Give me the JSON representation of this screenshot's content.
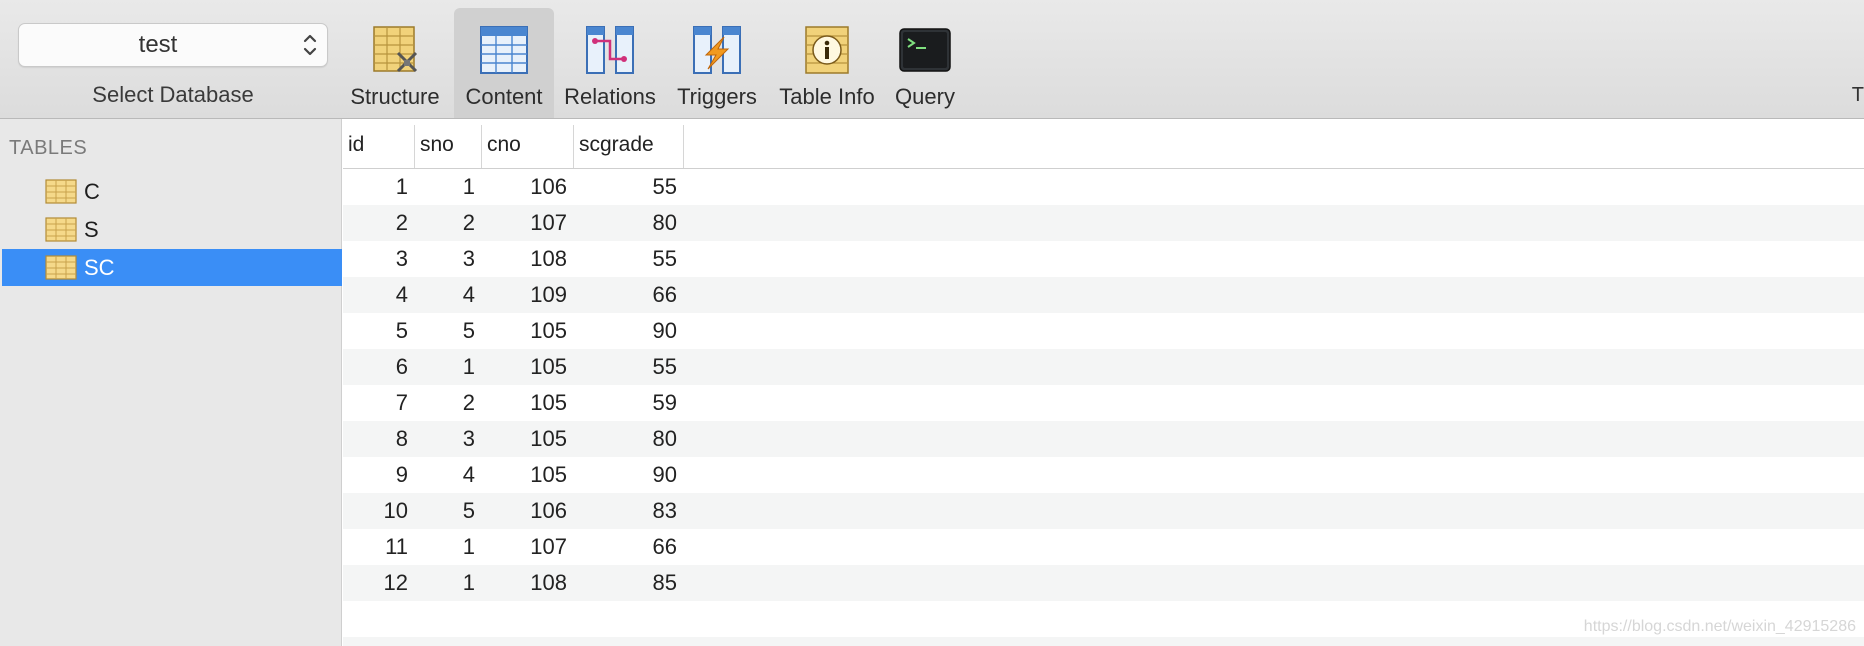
{
  "toolbar": {
    "database_value": "test",
    "database_label": "Select Database",
    "tabs": [
      {
        "label": "Structure"
      },
      {
        "label": "Content"
      },
      {
        "label": "Relations"
      },
      {
        "label": "Triggers"
      },
      {
        "label": "Table Info"
      },
      {
        "label": "Query"
      }
    ],
    "active_tab": "Content",
    "edge_text": "T"
  },
  "sidebar": {
    "heading": "TABLES",
    "items": [
      {
        "label": "C",
        "icon": "table-icon"
      },
      {
        "label": "S",
        "icon": "table-icon"
      },
      {
        "label": "SC",
        "icon": "table-icon",
        "selected": true
      }
    ],
    "selected_color": "#3a8ef6"
  },
  "table": {
    "columns": [
      "id",
      "sno",
      "cno",
      "scgrade"
    ],
    "rows": [
      [
        "1",
        "1",
        "106",
        "55"
      ],
      [
        "2",
        "2",
        "107",
        "80"
      ],
      [
        "3",
        "3",
        "108",
        "55"
      ],
      [
        "4",
        "4",
        "109",
        "66"
      ],
      [
        "5",
        "5",
        "105",
        "90"
      ],
      [
        "6",
        "1",
        "105",
        "55"
      ],
      [
        "7",
        "2",
        "105",
        "59"
      ],
      [
        "8",
        "3",
        "105",
        "80"
      ],
      [
        "9",
        "4",
        "105",
        "90"
      ],
      [
        "10",
        "5",
        "106",
        "83"
      ],
      [
        "11",
        "1",
        "107",
        "66"
      ],
      [
        "12",
        "1",
        "108",
        "85"
      ]
    ]
  },
  "watermark": "https://blog.csdn.net/weixin_42915286"
}
